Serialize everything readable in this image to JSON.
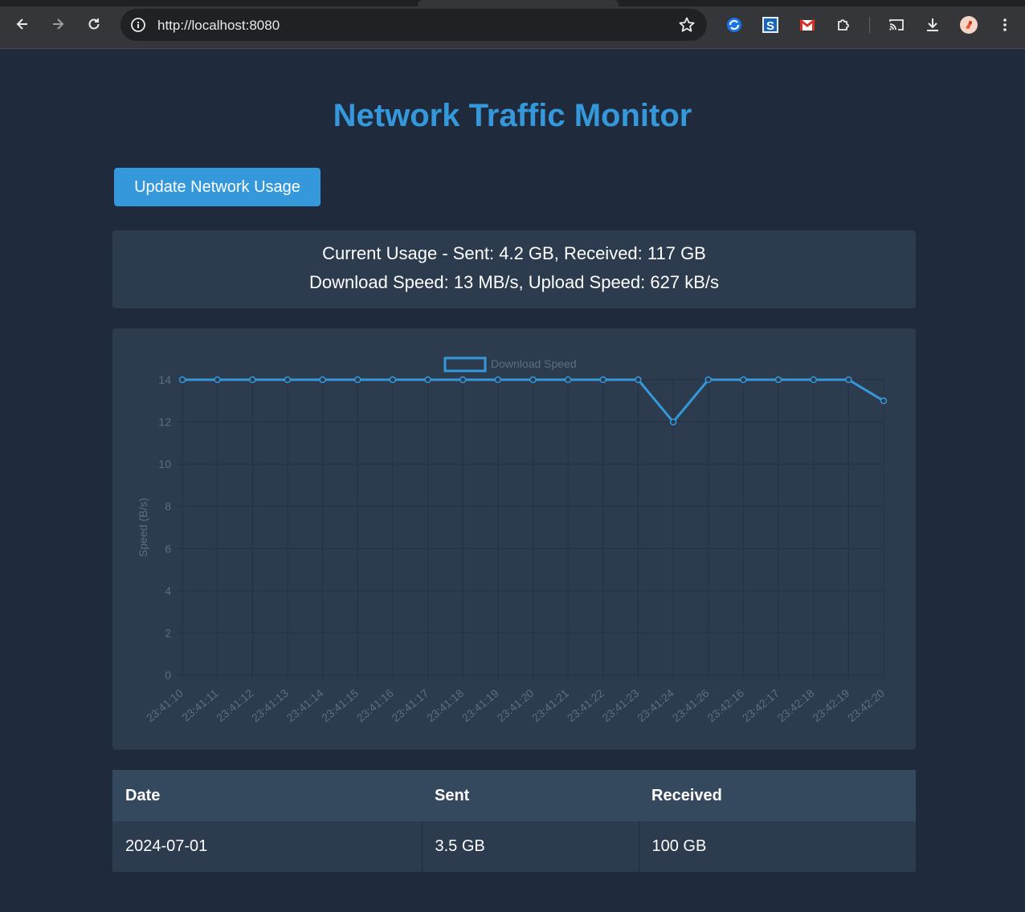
{
  "browser": {
    "url": "http://localhost:8080",
    "back_icon": "arrow-left-icon",
    "forward_icon": "arrow-right-icon",
    "reload_icon": "reload-icon",
    "info_icon": "info-icon",
    "bookmark_icon": "star-icon",
    "extensions": [
      "extension-blue-icon",
      "extension-s-icon",
      "gmail-icon",
      "puzzle-icon",
      "cast-icon",
      "download-icon",
      "profile-avatar",
      "menu-dots-icon"
    ]
  },
  "page": {
    "title": "Network Traffic Monitor",
    "update_button": "Update Network Usage",
    "usage_line": "Current Usage - Sent: 4.2 GB, Received: 117 GB",
    "speed_line": "Download Speed: 13 MB/s, Upload Speed: 627 kB/s"
  },
  "chart_data": {
    "type": "line",
    "series": [
      {
        "name": "Download Speed",
        "color": "#3498db",
        "values": [
          14,
          14,
          14,
          14,
          14,
          14,
          14,
          14,
          14,
          14,
          14,
          14,
          14,
          14,
          12,
          14,
          14,
          14,
          14,
          14,
          13
        ]
      }
    ],
    "categories": [
      "23:41:10",
      "23:41:11",
      "23:41:12",
      "23:41:13",
      "23:41:14",
      "23:41:15",
      "23:41:16",
      "23:41:17",
      "23:41:18",
      "23:41:19",
      "23:41:20",
      "23:41:21",
      "23:41:22",
      "23:41:23",
      "23:41:24",
      "23:41:26",
      "23:42:16",
      "23:42:17",
      "23:42:18",
      "23:42:19",
      "23:42:20"
    ],
    "ylabel": "Speed (B/s)",
    "xlabel": "",
    "ylim": [
      0,
      14
    ],
    "yticks": [
      0,
      2,
      4,
      6,
      8,
      10,
      12,
      14
    ],
    "grid": true,
    "legend": "top-center"
  },
  "table": {
    "headers": [
      "Date",
      "Sent",
      "Received"
    ],
    "rows": [
      [
        "2024-07-01",
        "3.5 GB",
        "100 GB"
      ]
    ]
  }
}
